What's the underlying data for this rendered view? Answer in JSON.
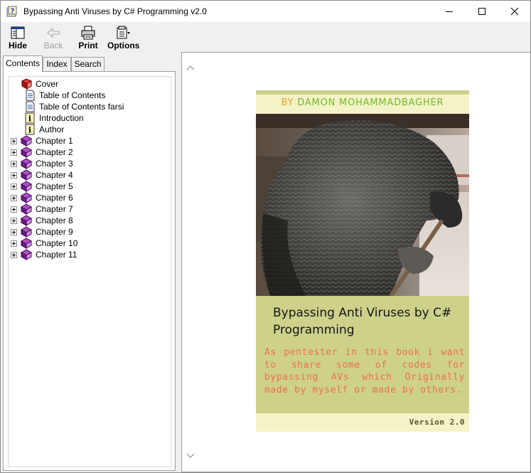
{
  "window": {
    "title": "Bypassing Anti Viruses by C# Programming v2.0",
    "minimize_icon": "minimize-icon",
    "maximize_icon": "maximize-icon",
    "close_icon": "close-icon"
  },
  "toolbar": {
    "hide_label": "Hide",
    "back_label": "Back",
    "print_label": "Print",
    "options_label": "Options"
  },
  "tabs": {
    "contents": "Contents",
    "index": "Index",
    "search": "Search"
  },
  "tree": {
    "items": [
      {
        "label": "Cover",
        "icon": "red-book-icon",
        "expandable": false
      },
      {
        "label": "Table of Contents",
        "icon": "page-icon",
        "expandable": false
      },
      {
        "label": "Table of Contents farsi",
        "icon": "page-icon",
        "expandable": false
      },
      {
        "label": "Introduction",
        "icon": "info-icon",
        "expandable": false
      },
      {
        "label": "Author",
        "icon": "info-icon",
        "expandable": false
      },
      {
        "label": "Chapter 1",
        "icon": "purple-book-icon",
        "expandable": true
      },
      {
        "label": "Chapter 2",
        "icon": "purple-book-icon",
        "expandable": true
      },
      {
        "label": "Chapter 3",
        "icon": "purple-book-icon",
        "expandable": true
      },
      {
        "label": "Chapter 4",
        "icon": "purple-book-icon",
        "expandable": true
      },
      {
        "label": "Chapter 5",
        "icon": "purple-book-icon",
        "expandable": true
      },
      {
        "label": "Chapter 6",
        "icon": "purple-book-icon",
        "expandable": true
      },
      {
        "label": "Chapter 7",
        "icon": "purple-book-icon",
        "expandable": true
      },
      {
        "label": "Chapter 8",
        "icon": "purple-book-icon",
        "expandable": true
      },
      {
        "label": "Chapter 9",
        "icon": "purple-book-icon",
        "expandable": true
      },
      {
        "label": "Chapter 10",
        "icon": "purple-book-icon",
        "expandable": true
      },
      {
        "label": "Chapter 11",
        "icon": "purple-book-icon",
        "expandable": true
      }
    ]
  },
  "cover": {
    "by": "BY",
    "author": "DAMON MOHAMMADBAGHER",
    "title": "Bypassing Anti Viruses by C# Programming",
    "description": "As pentester in this book i want to share some of codes for bypassing AVs which Originally made by myself or made by others.",
    "version": "Version 2.0",
    "photo": "parrot-photo",
    "colors": {
      "band": "#f4f3c8",
      "panel": "#cdd18a",
      "author": "#76b82a",
      "by": "#e3a427",
      "description": "#f0704a"
    }
  }
}
